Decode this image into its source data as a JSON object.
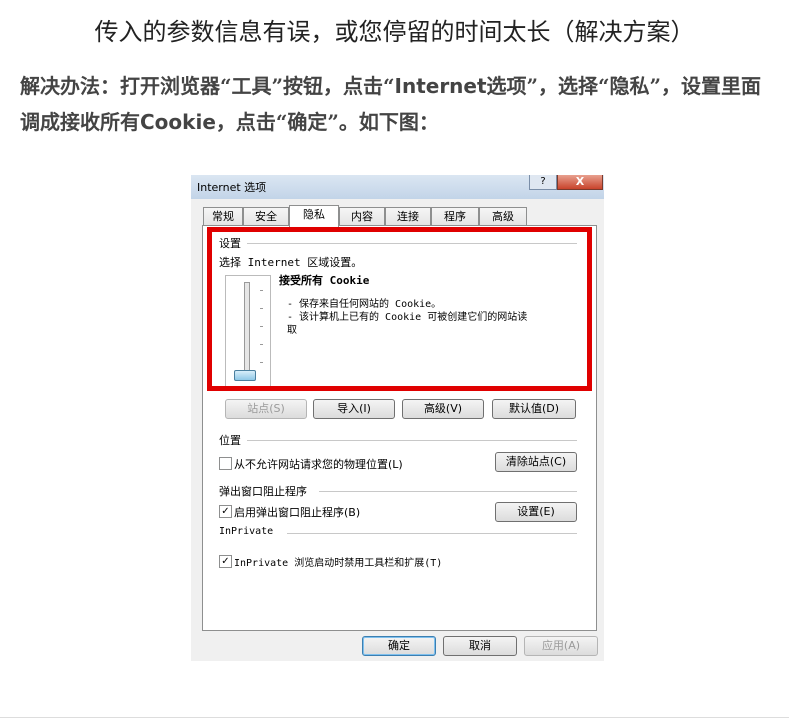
{
  "page": {
    "title": "传入的参数信息有误，或您停留的时间太长（解决方案）",
    "instruction_part1": "解决办法：打开浏览器“工具”按钮，点击“",
    "instruction_bold1": "Internet",
    "instruction_part2": "选项”，选择“隐私”，设置里面调成接收所有",
    "instruction_bold2": "Cookie",
    "instruction_part3": "，点击“确定”。如下图："
  },
  "dialog": {
    "window_title": "Internet 选项",
    "help_button": "?",
    "close_button": "X",
    "tabs": [
      {
        "label": "常规"
      },
      {
        "label": "安全"
      },
      {
        "label": "隐私"
      },
      {
        "label": "内容"
      },
      {
        "label": "连接"
      },
      {
        "label": "程序"
      },
      {
        "label": "高级"
      }
    ],
    "active_tab": "隐私",
    "settings": {
      "heading": "设置",
      "zone_text": "选择 Internet 区域设置。",
      "level_title": "接受所有 Cookie",
      "bullet1": "- 保存来自任何网站的 Cookie。",
      "bullet2": "- 该计算机上已有的 Cookie 可被创建它们的网站读",
      "bullet2_cont": "取",
      "slider_level": 0
    },
    "settings_buttons": [
      {
        "label": "站点(S)",
        "disabled": true
      },
      {
        "label": "导入(I)",
        "disabled": false
      },
      {
        "label": "高级(V)",
        "disabled": false
      },
      {
        "label": "默认值(D)",
        "disabled": false
      }
    ],
    "location": {
      "heading": "位置",
      "checkbox_label": "从不允许网站请求您的物理位置(L)",
      "checked": false,
      "clear_button": "清除站点(C)"
    },
    "popup": {
      "heading": "弹出窗口阻止程序",
      "checkbox_label": "启用弹出窗口阻止程序(B)",
      "checked": true,
      "settings_button": "设置(E)"
    },
    "inprivate": {
      "heading": "InPrivate",
      "checkbox_label": "InPrivate 浏览启动时禁用工具栏和扩展(T)",
      "checked": true
    },
    "footer_buttons": {
      "ok": "确定",
      "cancel": "取消",
      "apply": "应用(A)"
    },
    "colors": {
      "highlight_frame": "#e00000"
    }
  }
}
